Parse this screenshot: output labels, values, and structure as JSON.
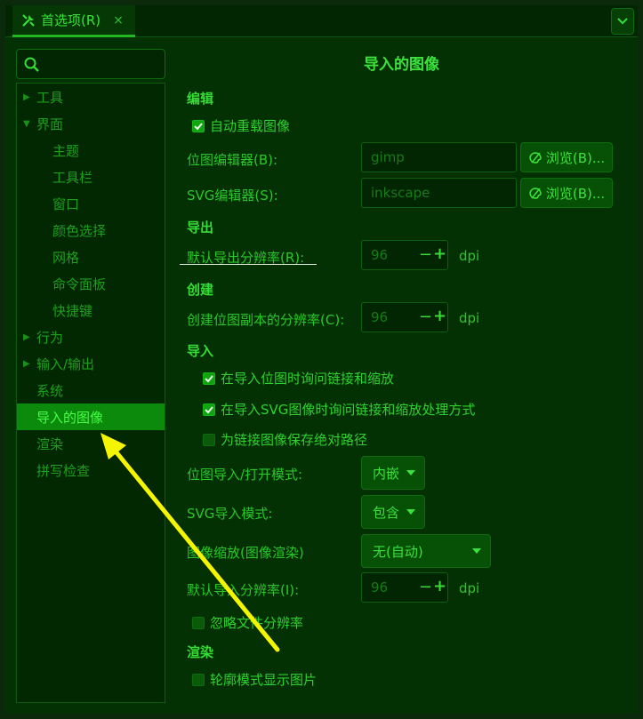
{
  "tab": {
    "title": "首选项(R)",
    "close": "×"
  },
  "search": {
    "placeholder": ""
  },
  "sidebar": {
    "items": [
      {
        "label": "工具",
        "arrow": "▶"
      },
      {
        "label": "界面",
        "arrow": "▼"
      },
      {
        "label": "主题"
      },
      {
        "label": "工具栏"
      },
      {
        "label": "窗口"
      },
      {
        "label": "颜色选择"
      },
      {
        "label": "网格"
      },
      {
        "label": "命令面板"
      },
      {
        "label": "快捷键"
      },
      {
        "label": "行为",
        "arrow": "▶"
      },
      {
        "label": "输入/输出",
        "arrow": "▶"
      },
      {
        "label": "系统"
      },
      {
        "label": "导入的图像"
      },
      {
        "label": "渲染"
      },
      {
        "label": "拼写检查"
      }
    ]
  },
  "main": {
    "title": "导入的图像",
    "edit": {
      "section": "编辑",
      "auto_reload": "自动重载图像",
      "bitmap_editor_label": "位图编辑器(B):",
      "bitmap_editor_value": "gimp",
      "svg_editor_label": "SVG编辑器(S):",
      "svg_editor_value": "inkscape",
      "browse": "浏览(B)..."
    },
    "export": {
      "section": "导出",
      "resolution_label": "默认导出分辨率(R):",
      "resolution_value": "96",
      "unit": "dpi"
    },
    "create": {
      "section": "创建",
      "resolution_label": "创建位图副本的分辨率(C):",
      "resolution_value": "96",
      "unit": "dpi"
    },
    "import": {
      "section": "导入",
      "ask_bitmap": "在导入位图时询问链接和缩放",
      "ask_svg": "在导入SVG图像时询问链接和缩放处理方式",
      "store_absolute": "为链接图像保存绝对路径",
      "bitmap_mode_label": "位图导入/打开模式:",
      "bitmap_mode_value": "内嵌",
      "svg_mode_label": "SVG导入模式:",
      "svg_mode_value": "包含",
      "scaling_label": "图像缩放(图像渲染)",
      "scaling_value": "无(自动)",
      "resolution_label": "默认导入分辨率(I):",
      "resolution_value": "96",
      "unit": "dpi",
      "ignore_resolution": "忽略文件分辨率"
    },
    "render": {
      "section": "渲染",
      "outline_show": "轮廓模式显示图片"
    },
    "minus": "−",
    "plus": "+"
  },
  "colors": {
    "accent": "#2fd12f",
    "selected_bg": "#0b8a0b",
    "annotation_arrow": "#f5f500"
  }
}
